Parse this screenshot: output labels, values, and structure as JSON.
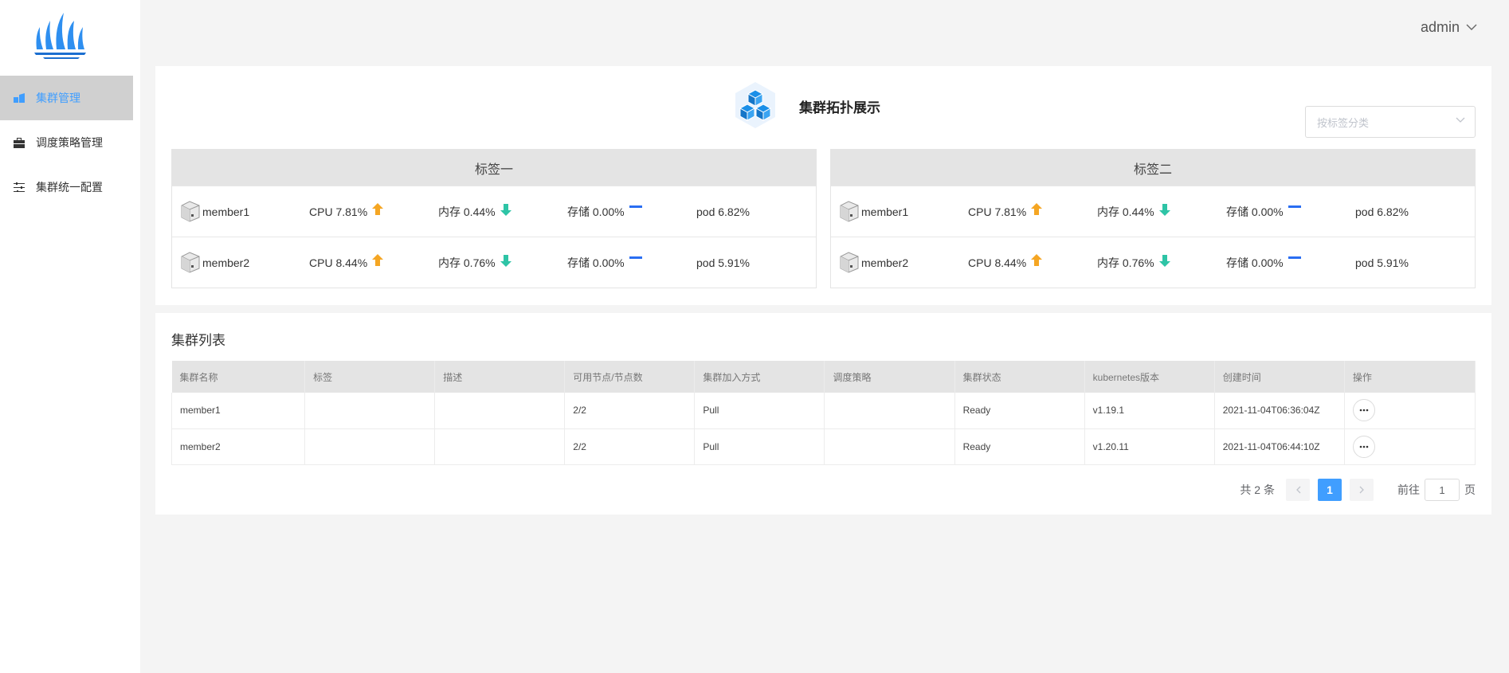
{
  "header": {
    "user": "admin"
  },
  "sidebar": {
    "items": [
      {
        "label": "集群管理",
        "icon": "cluster-icon",
        "active": true
      },
      {
        "label": "调度策略管理",
        "icon": "briefcase-icon",
        "active": false
      },
      {
        "label": "集群统一配置",
        "icon": "sliders-icon",
        "active": false
      }
    ]
  },
  "topology": {
    "title": "集群拓扑展示",
    "select_placeholder": "按标签分类",
    "groups": [
      {
        "label": "标签一",
        "members": [
          {
            "name": "member1",
            "cpu": "CPU 7.81%",
            "cpu_trend": "up",
            "mem": "内存 0.44%",
            "mem_trend": "down",
            "storage": "存储 0.00%",
            "storage_trend": "flat",
            "pod": "pod 6.82%"
          },
          {
            "name": "member2",
            "cpu": "CPU 8.44%",
            "cpu_trend": "up",
            "mem": "内存 0.76%",
            "mem_trend": "down",
            "storage": "存储 0.00%",
            "storage_trend": "flat",
            "pod": "pod 5.91%"
          }
        ]
      },
      {
        "label": "标签二",
        "members": [
          {
            "name": "member1",
            "cpu": "CPU 7.81%",
            "cpu_trend": "up",
            "mem": "内存 0.44%",
            "mem_trend": "down",
            "storage": "存储 0.00%",
            "storage_trend": "flat",
            "pod": "pod 6.82%"
          },
          {
            "name": "member2",
            "cpu": "CPU 8.44%",
            "cpu_trend": "up",
            "mem": "内存 0.76%",
            "mem_trend": "down",
            "storage": "存储 0.00%",
            "storage_trend": "flat",
            "pod": "pod 5.91%"
          }
        ]
      }
    ]
  },
  "cluster_list": {
    "title": "集群列表",
    "columns": [
      "集群名称",
      "标签",
      "描述",
      "可用节点/节点数",
      "集群加入方式",
      "调度策略",
      "集群状态",
      "kubernetes版本",
      "创建时间",
      "操作"
    ],
    "rows": [
      [
        "member1",
        "",
        "",
        "2/2",
        "Pull",
        "",
        "Ready",
        "v1.19.1",
        "2021-11-04T06:36:04Z"
      ],
      [
        "member2",
        "",
        "",
        "2/2",
        "Pull",
        "",
        "Ready",
        "v1.20.11",
        "2021-11-04T06:44:10Z"
      ]
    ]
  },
  "pagination": {
    "total": "共 2 条",
    "current_page": "1",
    "goto_prefix": "前往",
    "goto_value": "1",
    "goto_suffix": "页"
  },
  "colors": {
    "accent": "#409eff",
    "up": "#f5a623",
    "down": "#2ec4a6",
    "flat": "#2a6ef2"
  }
}
